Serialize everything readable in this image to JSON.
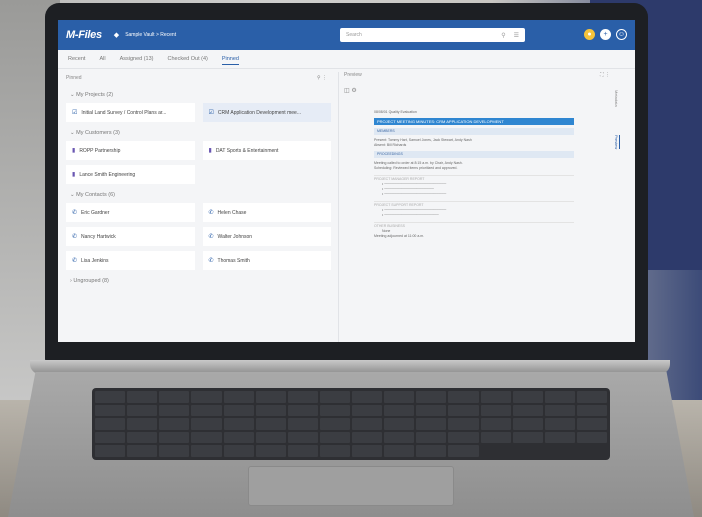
{
  "app": {
    "logo": "M-Files",
    "vault": "Sample Vault > Recent"
  },
  "search": {
    "placeholder": "Search"
  },
  "tabs": [
    "Recent",
    "All",
    "Assigned (13)",
    "Checked Out (4)",
    "Pinned"
  ],
  "left": {
    "title": "Pinned",
    "projects": {
      "header": "My Projects (2)",
      "items": [
        "Initial Land Survey / Control Plans ar...",
        "CRM Application Development mee..."
      ]
    },
    "customers": {
      "header": "My Customers (3)",
      "items": [
        "ROPP Partnership",
        "DAT Sports & Entertainment",
        "Lance Smith Engineering"
      ]
    },
    "contacts": {
      "header": "My Contacts (6)",
      "items": [
        "Eric Gardner",
        "Helen Chase",
        "Nancy Hartwick",
        "Walter Johnson",
        "Lisa Jenkins",
        "Thomas Smith"
      ]
    },
    "ungrouped": "Ungrouped (8)"
  },
  "preview": {
    "title": "Preview",
    "doc": {
      "header_line": "08/08/01  Quality Evaluation",
      "title_bar": "PROJECT MEETING MINUTES: CRM APPLICATION DEVELOPMENT",
      "members_h": "MEMBERS",
      "members_1": "Present: Tommy Hart, Samuel Jones, Jack Stewart, Andy Nash",
      "members_2": "Absent: Bill Richards",
      "proceedings_h": "PROCEEDINGS",
      "proc_1": "Meeting called to order at 8:15 a.m. by Chair, Andy Nash.",
      "proc_2": "Scheduling: Reviewed items prioritized and approved.",
      "sec_1": "PROJECT MANAGER REPORT",
      "sec_2": "PROJECT SUPPORT REPORT",
      "sec_3": "OTHER BUSINESS",
      "sec_3_item": "None",
      "adjourn": "Meeting adjourned at 11:00 a.m."
    },
    "side_tabs": [
      "Metadata",
      "Preview"
    ]
  }
}
